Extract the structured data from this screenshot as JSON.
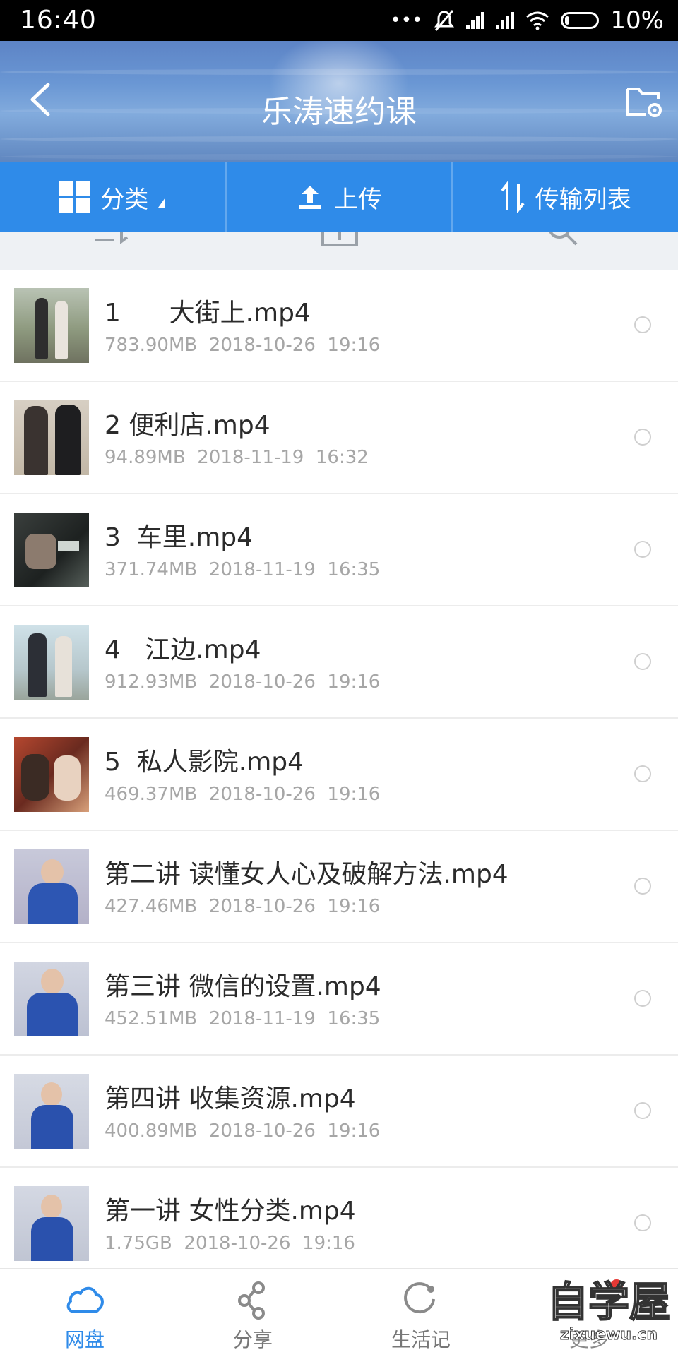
{
  "status": {
    "time": "16:40",
    "dots": "•••",
    "battery": "10%"
  },
  "header": {
    "title": "乐涛速约课"
  },
  "toolbar": {
    "category_label": "分类",
    "upload_label": "上传",
    "transfer_label": "传输列表"
  },
  "files": [
    {
      "name": "1      大街上.mp4",
      "size": "783.90MB",
      "date": "2018-10-26  19:16"
    },
    {
      "name": "2 便利店.mp4",
      "size": "94.89MB",
      "date": "2018-11-19  16:32"
    },
    {
      "name": "3  车里.mp4",
      "size": "371.74MB",
      "date": "2018-11-19  16:35"
    },
    {
      "name": "4   江边.mp4",
      "size": "912.93MB",
      "date": "2018-10-26  19:16"
    },
    {
      "name": "5  私人影院.mp4",
      "size": "469.37MB",
      "date": "2018-10-26  19:16"
    },
    {
      "name": "第二讲 读懂女人心及破解方法.mp4",
      "size": "427.46MB",
      "date": "2018-10-26  19:16"
    },
    {
      "name": "第三讲 微信的设置.mp4",
      "size": "452.51MB",
      "date": "2018-11-19  16:35"
    },
    {
      "name": "第四讲 收集资源.mp4",
      "size": "400.89MB",
      "date": "2018-10-26  19:16"
    },
    {
      "name": "第一讲 女性分类.mp4",
      "size": "1.75GB",
      "date": "2018-10-26  19:16"
    }
  ],
  "bottom_nav": {
    "items": [
      {
        "label": "网盘",
        "icon": "cloud-icon"
      },
      {
        "label": "分享",
        "icon": "share-icon"
      },
      {
        "label": "生活记",
        "icon": "circle-arrow-icon"
      },
      {
        "label": "更多",
        "icon": "more-icon"
      }
    ]
  },
  "watermark": {
    "title": "自学屋",
    "site": "zixuewu.cn"
  },
  "colors": {
    "accent": "#2f8be9",
    "active_tab": "#2f8be9",
    "badge": "#e53935"
  }
}
